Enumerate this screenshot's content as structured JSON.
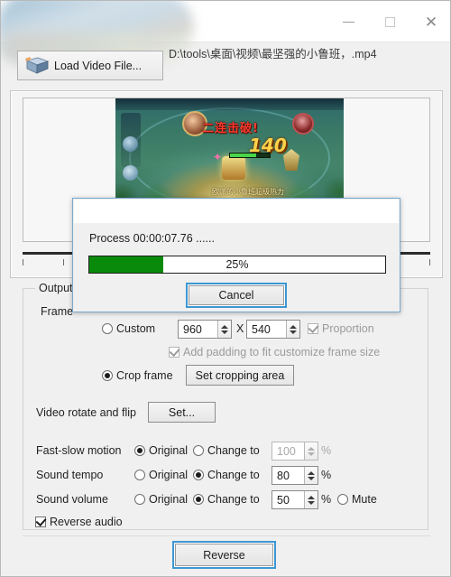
{
  "window": {
    "title": "",
    "title_obscured": true,
    "controls": {
      "minimize": "–",
      "maximize": "□",
      "close": "✕"
    }
  },
  "toolbar": {
    "load_button_label": "Load Video File...",
    "load_button_icon": "book-icon",
    "file_path": "D:\\tools\\桌面\\视频\\最坚强的小鲁班，.mp4"
  },
  "preview": {
    "caption_kill": "二连击破!",
    "caption_number": "140",
    "caption_small": "欧派的小鲁班超级热力",
    "timeline_ticks": 11
  },
  "output_group": {
    "legend": "Output o",
    "frame_label": "Frame ",
    "custom": {
      "radio_label": "Custom",
      "selected": false,
      "width": "960",
      "separator": "X",
      "height": "540",
      "proportion_label": "Proportion",
      "proportion_checked": true,
      "proportion_disabled": true
    },
    "padding": {
      "label": "Add padding to fit customize frame size",
      "checked": true,
      "disabled": true
    },
    "crop": {
      "radio_label": "Crop frame",
      "selected": true,
      "button_label": "Set cropping area"
    },
    "rotate": {
      "label": "Video rotate and flip",
      "button_label": "Set..."
    },
    "fast_slow_motion": {
      "label": "Fast-slow motion",
      "original_label": "Original",
      "change_label": "Change to",
      "selected": "original",
      "value": "100",
      "unit": "%",
      "disabled": true
    },
    "sound_tempo": {
      "label": "Sound tempo",
      "original_label": "Original",
      "change_label": "Change to",
      "selected": "change",
      "value": "80",
      "unit": "%",
      "disabled": false
    },
    "sound_volume": {
      "label": "Sound volume",
      "original_label": "Original",
      "change_label": "Change to",
      "selected": "change",
      "value": "50",
      "unit": "%",
      "mute_label": "Mute",
      "mute_selected": false,
      "disabled": false
    },
    "reverse_audio": {
      "label": "Reverse audio",
      "checked": true
    }
  },
  "footer": {
    "reverse_button_label": "Reverse"
  },
  "progress_dialog": {
    "title": "",
    "process_text": "Process 00:00:07.76 ......",
    "percent_label": "25%",
    "percent_value": 25,
    "cancel_label": "Cancel",
    "bar_fill_color": "#0a8a0a"
  }
}
